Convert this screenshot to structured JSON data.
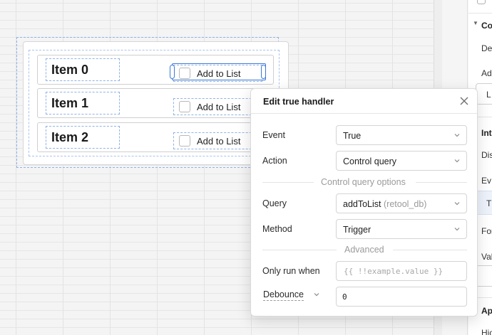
{
  "list": {
    "items": [
      {
        "title": "Item 0",
        "checkbox_label": "Add to List"
      },
      {
        "title": "Item 1",
        "checkbox_label": "Add to List"
      },
      {
        "title": "Item 2",
        "checkbox_label": "Add to List"
      }
    ]
  },
  "inspector": {
    "section_co": "Co",
    "de": "De",
    "ad": "Ad",
    "l": "L",
    "section_int": "Int",
    "dis": "Dis",
    "ev": "Ev",
    "t": "T",
    "for": "For",
    "val": "Val",
    "section_ap": "Ap",
    "hid": "Hid"
  },
  "popover": {
    "title": "Edit true handler",
    "close_icon": "close-icon",
    "event": {
      "label": "Event",
      "value": "True"
    },
    "action": {
      "label": "Action",
      "value": "Control query"
    },
    "control_query_section": "Control query options",
    "query": {
      "label": "Query",
      "value": "addToList",
      "sub": "(retool_db)"
    },
    "method": {
      "label": "Method",
      "value": "Trigger"
    },
    "advanced_section": "Advanced",
    "only_run_when": {
      "label": "Only run when",
      "placeholder": "{{ !!example.value }}"
    },
    "debounce": {
      "label": "Debounce",
      "value": "0"
    }
  },
  "colors": {
    "accent": "#3b78d8",
    "selection_dashed": "#8fb3e6"
  }
}
